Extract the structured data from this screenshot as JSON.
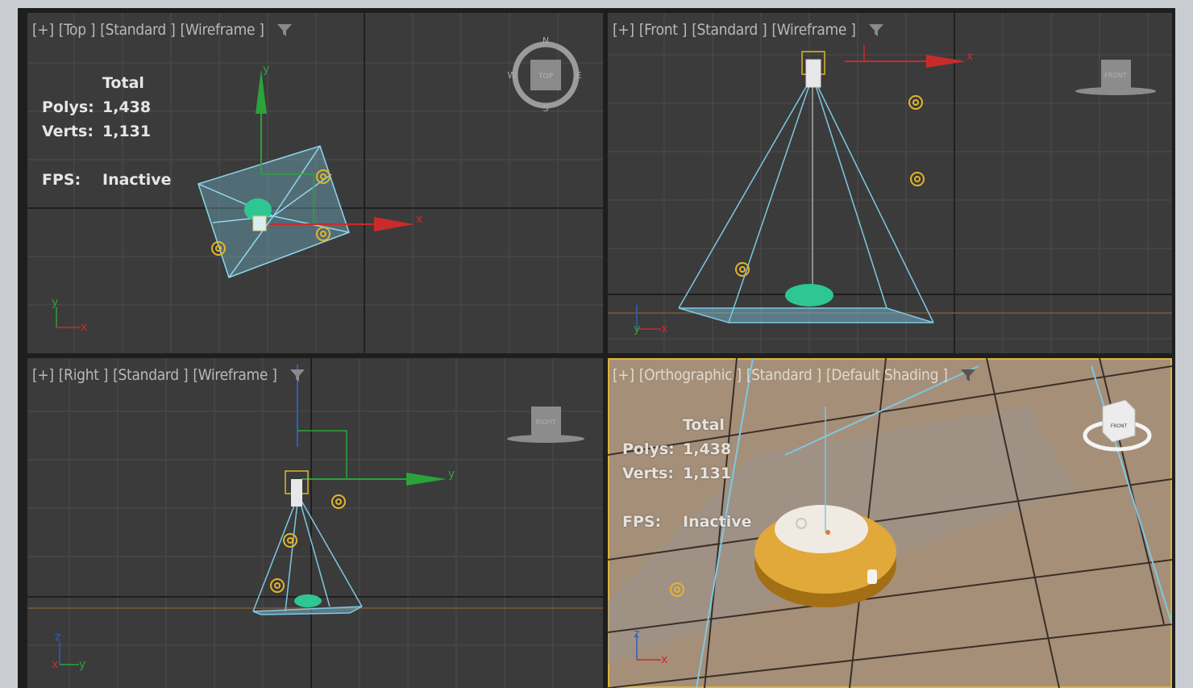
{
  "viewports": {
    "top": {
      "menu": "[+]",
      "name": "[Top ]",
      "shading": "[Standard ]",
      "mode": "[Wireframe ]",
      "axis_x": "x",
      "axis_y": "y",
      "cube_label": "TOP",
      "compass": {
        "n": "N",
        "s": "S",
        "e": "E",
        "w": "W"
      }
    },
    "front": {
      "menu": "[+]",
      "name": "[Front ]",
      "shading": "[Standard ]",
      "mode": "[Wireframe ]",
      "axis_x": "x",
      "axis_y": "y",
      "cube_label": "FRONT"
    },
    "right": {
      "menu": "[+]",
      "name": "[Right ]",
      "shading": "[Standard ]",
      "mode": "[Wireframe ]",
      "axis_y": "y",
      "axis_z": "z",
      "axis_x": "x",
      "cube_label": "RIGHT"
    },
    "persp": {
      "menu": "[+]",
      "name": "[Orthographic ]",
      "shading": "[Standard ]",
      "mode": "[Default Shading ]",
      "axis_x": "x",
      "axis_z": "z"
    }
  },
  "stats": {
    "total_label": "Total",
    "polys_label": "Polys:",
    "polys_value": "1,438",
    "verts_label": "Verts:",
    "verts_value": "1,131",
    "fps_label": "FPS:",
    "fps_value": "Inactive"
  },
  "colors": {
    "viewport_bg": "#3b3b3b",
    "grid": "#4a4a4a",
    "axis_red": "#c92b2b",
    "axis_green": "#2aa33b",
    "light_yellow": "#e3b52a",
    "wire_blue": "#7ec8e3",
    "active_border": "#d9b442",
    "floor": "#a58f79",
    "robot_body": "#e0a93a"
  }
}
